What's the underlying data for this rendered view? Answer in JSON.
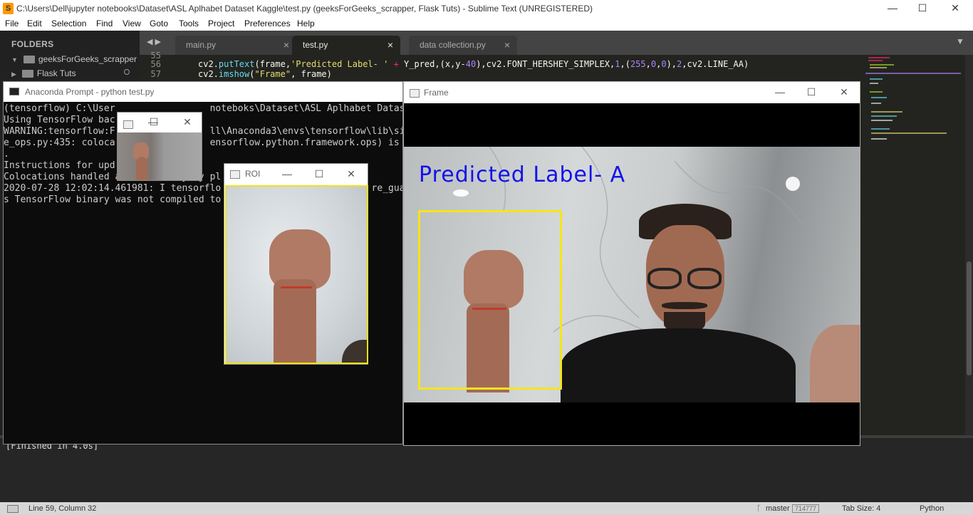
{
  "sublime": {
    "window_title": "C:\\Users\\Dell\\jupyter notebooks\\Dataset\\ASL Aplhabet Dataset Kaggle\\test.py (geeksForGeeks_scrapper, Flask Tuts) - Sublime Text (UNREGISTERED)",
    "menu": [
      "File",
      "Edit",
      "Selection",
      "Find",
      "View",
      "Goto",
      "Tools",
      "Project",
      "Preferences",
      "Help"
    ],
    "sidebar": {
      "header": "FOLDERS",
      "folders": [
        "geeksForGeeks_scrapper",
        "Flask Tuts"
      ]
    },
    "tabs": [
      {
        "label": "main.py"
      },
      {
        "label": "test.py"
      },
      {
        "label": "data collection.py"
      }
    ],
    "tab_close": "×",
    "nav_arrows": "◀ ▶",
    "tab_menu": "▼",
    "editor": {
      "line_numbers": [
        "55",
        "56",
        "57"
      ],
      "line56": {
        "a": "cv2.",
        "b": "putText",
        "c": "(frame,",
        "d": "'Predicted Label- '",
        "e": " + ",
        "f": "Y_pred,(x,y-",
        "g": "40",
        "h": "),cv2.FONT_HERSHEY_SIMPLEX,",
        "i": "1",
        "j": ",(",
        "k": "255",
        "l": ",",
        "m": "0",
        "n": ",",
        "o": "0",
        "p": "),",
        "q": "2",
        "r": ",cv2.LINE_AA)"
      },
      "line57": {
        "a": "cv2.",
        "b": "imshow",
        "c": "(",
        "d": "\"Frame\"",
        "e": ", frame)"
      }
    },
    "output": "[Finished in 4.0s]",
    "status": {
      "position": "Line 59, Column 32",
      "branch": "master",
      "badge": "714777",
      "tab_size": "Tab Size: 4",
      "syntax": "Python"
    }
  },
  "anaconda": {
    "title": "Anaconda Prompt - python  test.py",
    "lines": [
      "(tensorflow) C:\\User                 noteboks\\Dataset\\ASL Aplhabet Datas",
      "Using TensorFlow bac",
      "WARNING:tensorflow:F                 ll\\Anaconda3\\envs\\tensorflow\\lib\\si",
      "e_ops.py:435: coloca                 ensorflow.python.framework.ops) is",
      ".",
      "Instructions for upd",
      "Colocations handled automatically by pl",
      "2020-07-28 12:02:14.461981: I tensorflo                           re_gua",
      "s TensorFlow binary was not compiled to"
    ]
  },
  "roi_window": {
    "title": "ROI"
  },
  "frame_window": {
    "title": "Frame",
    "overlay_text": "Predicted Label- A"
  },
  "window_controls": {
    "minimize": "—",
    "maximize": "☐",
    "close": "✕"
  },
  "colors": {
    "prediction_text": "#1313e8",
    "bbox": "#f5e51b",
    "editor_bg": "#23241f"
  }
}
